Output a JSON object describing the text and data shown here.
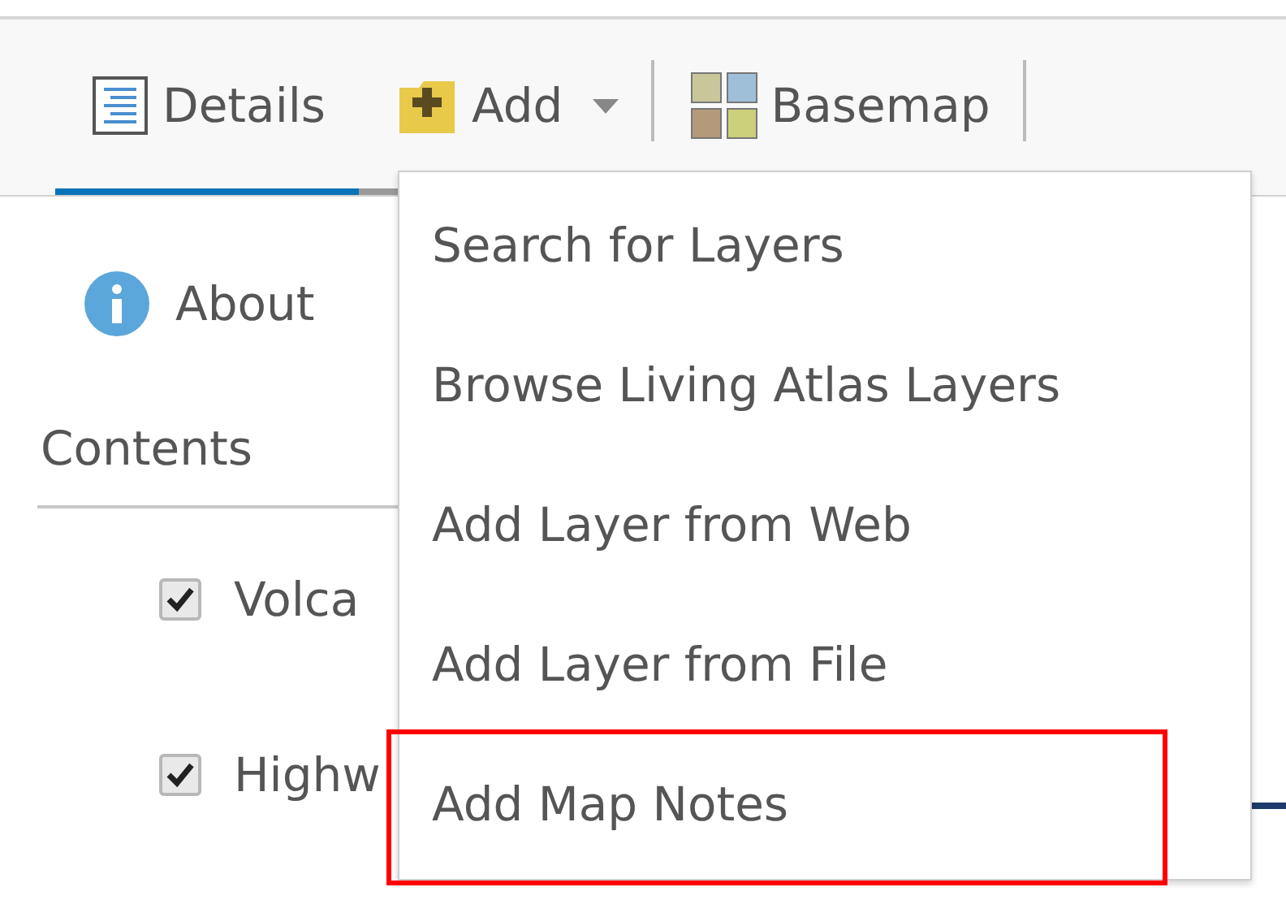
{
  "toolbar": {
    "tabs": [
      {
        "kind": "details",
        "label": "Details",
        "selected": true
      },
      {
        "kind": "add",
        "label": "Add",
        "selected": false,
        "dropdown": true
      },
      {
        "kind": "basemap",
        "label": "Basemap",
        "selected": false
      }
    ]
  },
  "panel": {
    "about": "About",
    "contents_heading": "Contents",
    "layers": [
      {
        "name": "Volca",
        "checked": true
      },
      {
        "name": "Highw",
        "checked": true
      }
    ]
  },
  "add_menu": {
    "items": [
      {
        "label": "Search for Layers",
        "highlighted": false
      },
      {
        "label": "Browse Living Atlas Layers",
        "highlighted": false
      },
      {
        "label": "Add Layer from Web",
        "highlighted": false
      },
      {
        "label": "Add Layer from File",
        "highlighted": false
      },
      {
        "label": "Add Map Notes",
        "highlighted": true
      }
    ]
  }
}
